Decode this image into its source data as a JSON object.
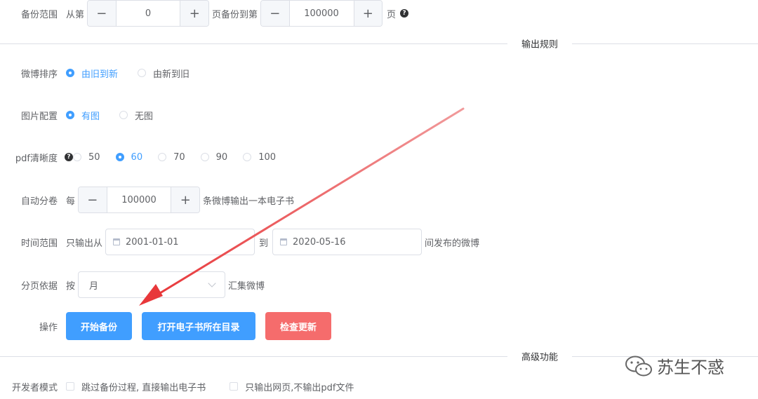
{
  "backup_range": {
    "label": "备份范围",
    "from_text": "从第",
    "from_value": "0",
    "middle_text": "页备份到第",
    "to_value": "100000",
    "suffix": "页"
  },
  "output_rules_divider": "输出规则",
  "weibo_order": {
    "label": "微博排序",
    "options": [
      "由旧到新",
      "由新到旧"
    ],
    "selected": 0
  },
  "image_config": {
    "label": "图片配置",
    "options": [
      "有图",
      "无图"
    ],
    "selected": 0
  },
  "pdf_quality": {
    "label": "pdf清晰度",
    "options": [
      "50",
      "60",
      "70",
      "90",
      "100"
    ],
    "selected": 1
  },
  "auto_split": {
    "label": "自动分卷",
    "prefix": "每",
    "value": "100000",
    "suffix": "条微博输出一本电子书"
  },
  "time_range": {
    "label": "时间范围",
    "prefix": "只输出从",
    "start": "2001-01-01",
    "middle": "到",
    "end": "2020-05-16",
    "suffix": "间发布的微博"
  },
  "pagination": {
    "label": "分页依据",
    "prefix": "按",
    "selected": "月",
    "suffix": "汇集微博"
  },
  "actions": {
    "label": "操作",
    "start_backup": "开始备份",
    "open_dir": "打开电子书所在目录",
    "check_update": "检查更新"
  },
  "advanced_divider": "高级功能",
  "developer_mode": {
    "label": "开发者模式",
    "option1": "跳过备份过程, 直接输出电子书",
    "option2": "只输出网页,不输出pdf文件"
  },
  "icons": {
    "help": "question-circle-icon",
    "calendar": "calendar-icon",
    "chevron": "chevron-down-icon"
  },
  "watermark": "苏生不惑",
  "colors": {
    "primary": "#409eff",
    "danger": "#f56c6c",
    "arrow": "#e8373a"
  }
}
